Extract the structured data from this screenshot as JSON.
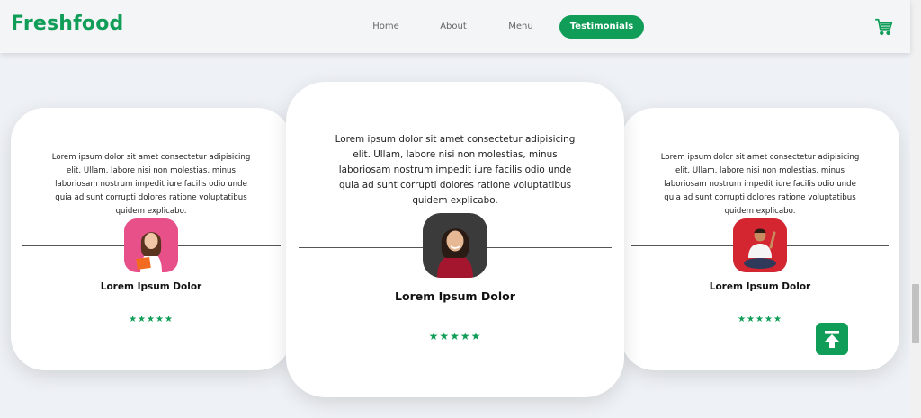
{
  "brand": {
    "logo": "Freshfood",
    "accent": "#0f9d58"
  },
  "nav": {
    "items": [
      {
        "label": "Home"
      },
      {
        "label": "About"
      },
      {
        "label": "Menu"
      },
      {
        "label": "Testimonials",
        "active": true
      }
    ],
    "cart_icon": "cart-icon"
  },
  "testimonials": [
    {
      "quote": "Lorem ipsum dolor sit amet consectetur adipisicing elit. Ullam, labore nisi non molestias, minus laboriosam nostrum impedit iure facilis odio unde quia ad sunt corrupti dolores ratione voluptatibus quidem explicabo.",
      "name": "Lorem Ipsum Dolor",
      "stars": "★★★★★",
      "rating": 5
    },
    {
      "quote": "Lorem ipsum dolor sit amet consectetur adipisicing elit. Ullam, labore nisi non molestias, minus laboriosam nostrum impedit iure facilis odio unde quia ad sunt corrupti dolores ratione voluptatibus quidem explicabo.",
      "name": "Lorem Ipsum Dolor",
      "stars": "★★★★★",
      "rating": 5
    },
    {
      "quote": "Lorem ipsum dolor sit amet consectetur adipisicing elit. Ullam, labore nisi non molestias, minus laboriosam nostrum impedit iure facilis odio unde quia ad sunt corrupti dolores ratione voluptatibus quidem explicabo.",
      "name": "Lorem Ipsum Dolor",
      "stars": "★★★★★",
      "rating": 5
    }
  ],
  "back_to_top_icon": "arrow-up-to-line-icon"
}
